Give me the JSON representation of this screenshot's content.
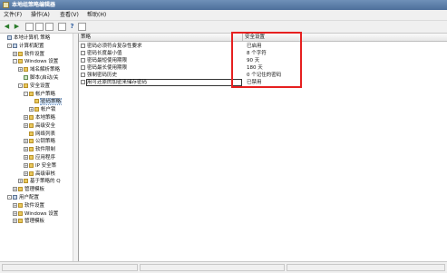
{
  "window": {
    "title": "本地组策略编辑器"
  },
  "menu": [
    "文件(F)",
    "操作(A)",
    "查看(V)",
    "帮助(H)"
  ],
  "toolbar": [
    "back-icon",
    "forward-icon",
    "up-icon",
    "show-hide-tree-icon",
    "refresh-icon",
    "export-icon",
    "help-icon",
    "properties-icon"
  ],
  "tree": [
    {
      "label": "本地计算机 策略",
      "indent": 0,
      "expander": "",
      "icon": "pc",
      "selected": false
    },
    {
      "label": "计算机配置",
      "indent": 1,
      "expander": "-",
      "icon": "pc",
      "selected": false
    },
    {
      "label": "软件设置",
      "indent": 2,
      "expander": "+",
      "icon": "folder",
      "selected": false
    },
    {
      "label": "Windows 设置",
      "indent": 2,
      "expander": "-",
      "icon": "folder",
      "selected": false
    },
    {
      "label": "域名解析策略",
      "indent": 3,
      "expander": "+",
      "icon": "folder",
      "selected": false
    },
    {
      "label": "脚本(启动/关",
      "indent": 3,
      "expander": "",
      "icon": "script",
      "selected": false
    },
    {
      "label": "安全设置",
      "indent": 3,
      "expander": "-",
      "icon": "folder",
      "selected": false
    },
    {
      "label": "帐户策略",
      "indent": 4,
      "expander": "-",
      "icon": "folder",
      "selected": false
    },
    {
      "label": "密码策略",
      "indent": 5,
      "expander": "",
      "icon": "folder",
      "selected": true
    },
    {
      "label": "帐户锁",
      "indent": 5,
      "expander": "+",
      "icon": "folder",
      "selected": false
    },
    {
      "label": "本地策略",
      "indent": 4,
      "expander": "+",
      "icon": "folder",
      "selected": false
    },
    {
      "label": "高级安全",
      "indent": 4,
      "expander": "+",
      "icon": "folder",
      "selected": false
    },
    {
      "label": "网络列表",
      "indent": 4,
      "expander": "",
      "icon": "folder",
      "selected": false
    },
    {
      "label": "公钥策略",
      "indent": 4,
      "expander": "+",
      "icon": "folder",
      "selected": false
    },
    {
      "label": "软件限制",
      "indent": 4,
      "expander": "+",
      "icon": "folder",
      "selected": false
    },
    {
      "label": "应用程序",
      "indent": 4,
      "expander": "+",
      "icon": "folder",
      "selected": false
    },
    {
      "label": "IP 安全策",
      "indent": 4,
      "expander": "+",
      "icon": "folder",
      "selected": false
    },
    {
      "label": "高级审核",
      "indent": 4,
      "expander": "+",
      "icon": "folder",
      "selected": false
    },
    {
      "label": "基于策略的 Q",
      "indent": 3,
      "expander": "+",
      "icon": "folder",
      "selected": false
    },
    {
      "label": "管理模板",
      "indent": 2,
      "expander": "+",
      "icon": "folder",
      "selected": false
    },
    {
      "label": "用户配置",
      "indent": 1,
      "expander": "-",
      "icon": "pc",
      "selected": false
    },
    {
      "label": "软件设置",
      "indent": 2,
      "expander": "+",
      "icon": "folder",
      "selected": false
    },
    {
      "label": "Windows 设置",
      "indent": 2,
      "expander": "+",
      "icon": "folder",
      "selected": false
    },
    {
      "label": "管理模板",
      "indent": 2,
      "expander": "+",
      "icon": "folder",
      "selected": false
    }
  ],
  "list": {
    "columns": [
      "策略",
      "安全设置"
    ],
    "rows": [
      {
        "name": "密码必须符合复杂性要求",
        "value": "已启用",
        "selected": false
      },
      {
        "name": "密码长度最小值",
        "value": "8 个字符",
        "selected": false
      },
      {
        "name": "密码最短使用期限",
        "value": "90 天",
        "selected": false
      },
      {
        "name": "密码最长使用期限",
        "value": "180 天",
        "selected": false
      },
      {
        "name": "强制密码历史",
        "value": "0 个记住的密码",
        "selected": false
      },
      {
        "name": "用可还原的加密来储存密码",
        "value": "已禁用",
        "selected": true
      }
    ]
  },
  "colors": {
    "highlight": "#e62020",
    "titlebar": "#4d6f9b",
    "selection": "#cfe2f7"
  }
}
